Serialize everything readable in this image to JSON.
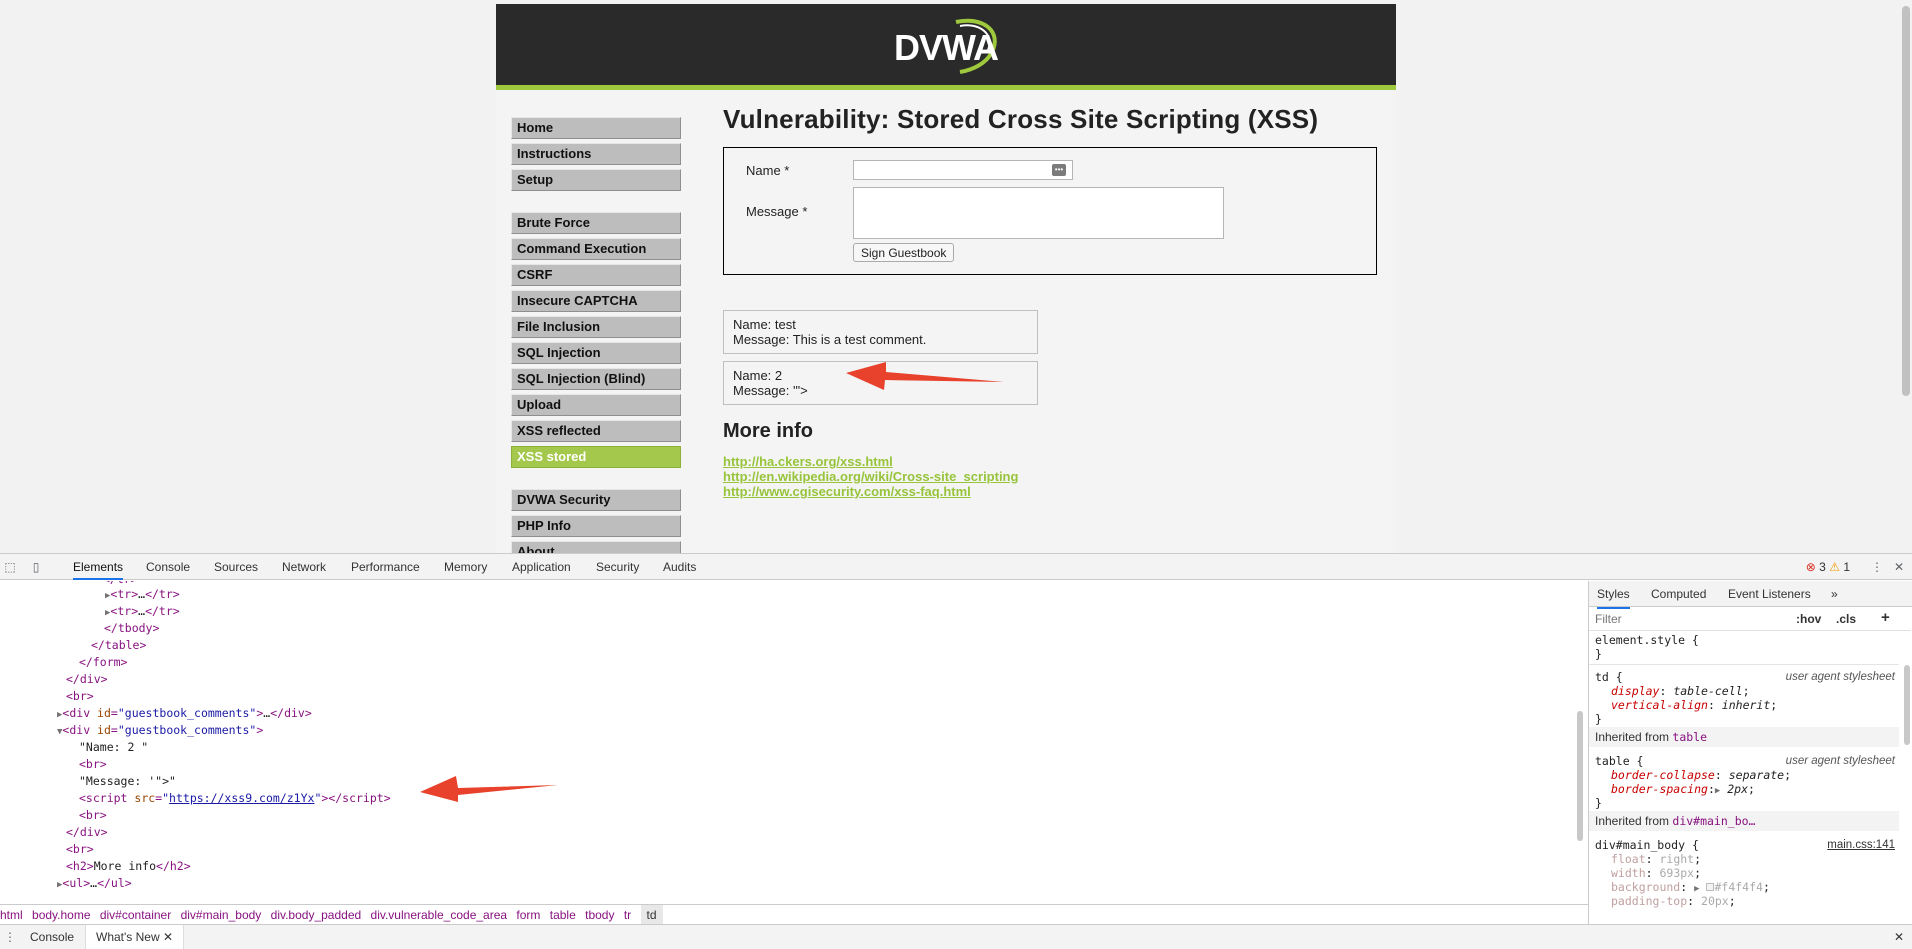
{
  "dvwa": {
    "logo_text": "DVWA",
    "menu": {
      "group1": [
        "Home",
        "Instructions",
        "Setup"
      ],
      "group2": [
        "Brute Force",
        "Command Execution",
        "CSRF",
        "Insecure CAPTCHA",
        "File Inclusion",
        "SQL Injection",
        "SQL Injection (Blind)",
        "Upload",
        "XSS reflected",
        "XSS stored"
      ],
      "group3": [
        "DVWA Security",
        "PHP Info",
        "About"
      ],
      "active": "XSS stored"
    },
    "title": "Vulnerability: Stored Cross Site Scripting (XSS)",
    "form": {
      "name_label": "Name *",
      "message_label": "Message *",
      "name_value": "",
      "message_value": "",
      "submit_label": "Sign Guestbook"
    },
    "comments": [
      {
        "name_line": "Name: test",
        "message_line": "Message: This is a test comment."
      },
      {
        "name_line": "Name: 2",
        "message_line": "Message: '\">"
      }
    ],
    "more_info_title": "More info",
    "links": [
      "http://ha.ckers.org/xss.html",
      "http://en.wikipedia.org/wiki/Cross-site_scripting",
      "http://www.cgisecurity.com/xss-faq.html"
    ]
  },
  "devtools": {
    "tabs": [
      "Elements",
      "Console",
      "Sources",
      "Network",
      "Performance",
      "Memory",
      "Application",
      "Security",
      "Audits"
    ],
    "active_tab": "Elements",
    "errors": "3",
    "warnings": "1",
    "script_src": "https://xss9.com/z1Yx",
    "text_name": "\"Name: 2 \"",
    "text_message": "\"Message: '\">\"",
    "h2_text": "More info",
    "guestbook_id": "guestbook_comments",
    "breadcrumb": [
      "html",
      "body.home",
      "div#container",
      "div#main_body",
      "div.body_padded",
      "div.vulnerable_code_area",
      "form",
      "table",
      "tbody",
      "tr",
      "td"
    ],
    "styles_tabs": [
      "Styles",
      "Computed",
      "Event Listeners"
    ],
    "filter_placeholder": "Filter",
    "hov_label": ":hov",
    "cls_label": ".cls",
    "element_style": "element.style {",
    "ua_label": "user agent stylesheet",
    "td_rule": {
      "selector": "td",
      "props": [
        [
          "display",
          "table-cell"
        ],
        [
          "vertical-align",
          "inherit"
        ]
      ]
    },
    "inherited_from_1": "Inherited from",
    "inherited_tag_1": "table",
    "table_rule": {
      "selector": "table",
      "props": [
        [
          "border-collapse",
          "separate"
        ],
        [
          "border-spacing",
          "2px"
        ]
      ]
    },
    "inherited_from_2": "Inherited from",
    "inherited_tag_2": "div#main_bo…",
    "main_body_rule": {
      "selector": "div#main_body",
      "source": "main.css:141",
      "props": [
        [
          "float",
          "right"
        ],
        [
          "width",
          "693px"
        ],
        [
          "background",
          "#f4f4f4"
        ],
        [
          "padding-top",
          "20px"
        ]
      ]
    },
    "drawer_tabs": [
      "Console",
      "What's New"
    ]
  }
}
